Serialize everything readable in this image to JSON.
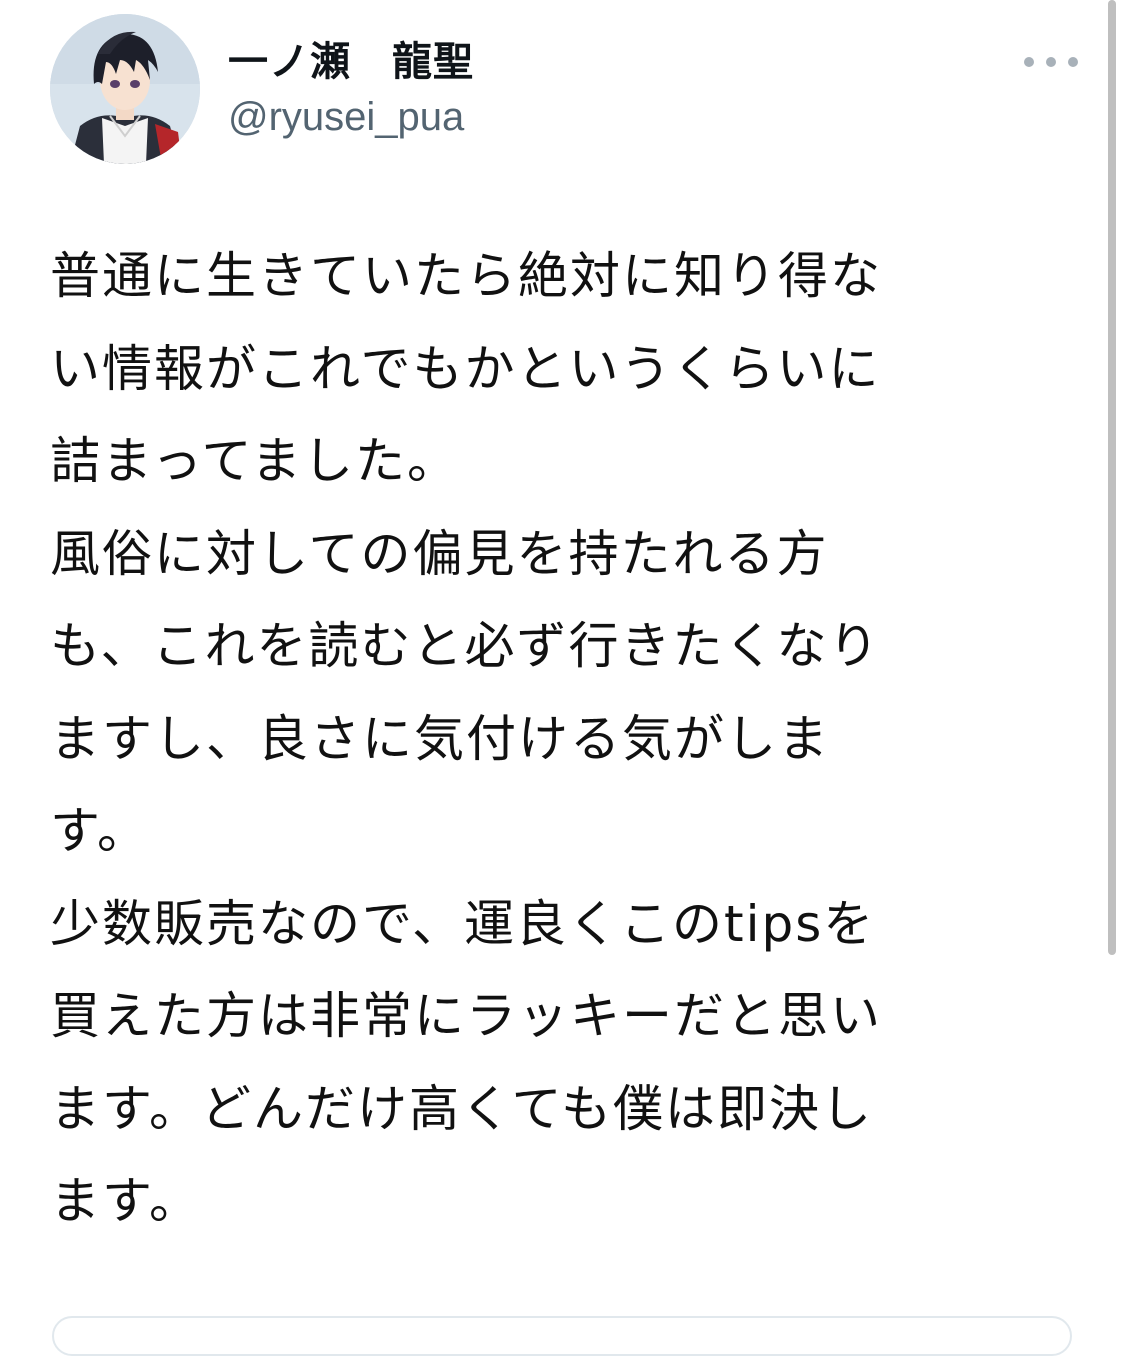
{
  "tweet": {
    "display_name": "一ノ瀬　龍聖",
    "handle": "@ryusei_pua",
    "more_icon": "more-horizontal-icon",
    "avatar_icon": "anime-avatar",
    "lines": [
      "普通に生きていたら絶対に知り得な",
      "い情報がこれでもかというくらいに",
      "詰まってました。",
      "風俗に対しての偏見を持たれる方",
      "も、これを読むと必ず行きたくなり",
      "ますし、良さに気付ける気がしま",
      "す。",
      "少数販売なので、運良くこのtipsを",
      "買えた方は非常にラッキーだと思い",
      "ます。どんだけ高くても僕は即決し",
      "ます。"
    ]
  },
  "colors": {
    "text": "#111111",
    "handle": "#536471",
    "dots": "#a8b1b9",
    "scrollbar": "#bfbfbf"
  }
}
